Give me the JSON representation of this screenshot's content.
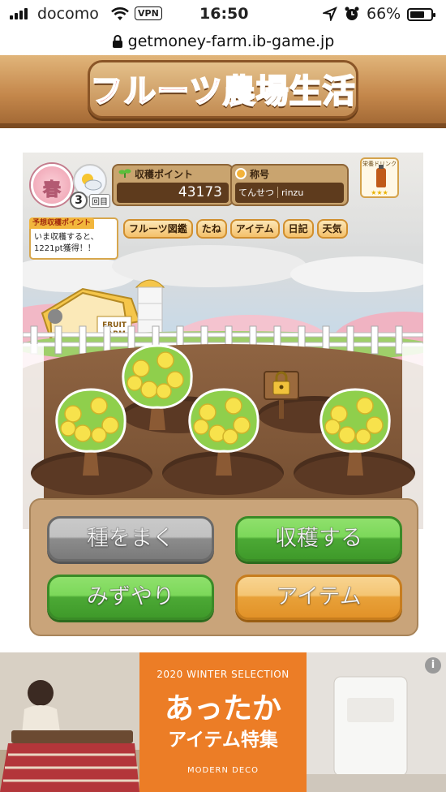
{
  "status_bar": {
    "carrier": "docomo",
    "vpn_label": "VPN",
    "time": "16:50",
    "battery": "66%",
    "battery_level": 0.66
  },
  "browser": {
    "url": "getmoney-farm.ib-game.jp"
  },
  "header": {
    "logo_text": "フルーツ農場生活"
  },
  "hud": {
    "season": "春",
    "round_number": "3",
    "round_unit": "回目",
    "points_label": "収穫ポイント",
    "points_value": "43173",
    "title_label": "称号",
    "title_rank": "てんせつ",
    "username": "rinzu",
    "drink_label": "栄養ドリンク",
    "drink_stars": "★★★",
    "forecast_title": "予想収穫ポイント",
    "forecast_line1": "いま収穫すると、",
    "forecast_line2": "1221pt獲得！！",
    "barn_sign_line1": "FRUIT",
    "barn_sign_line2": "FARM"
  },
  "menu_tabs": [
    {
      "label": "フルーツ図鑑"
    },
    {
      "label": "たね"
    },
    {
      "label": "アイテム"
    },
    {
      "label": "日記"
    },
    {
      "label": "天気"
    }
  ],
  "actions": {
    "sow": "種をまく",
    "harvest": "収穫する",
    "water": "みずやり",
    "item": "アイテム"
  },
  "ad": {
    "season_text": "2020 WINTER SELECTION",
    "headline": "あったか",
    "subline": "アイテム特集",
    "brand": "MODERN DECO",
    "info": "i"
  },
  "colors": {
    "sow_button": "#8c8c8c",
    "harvest_button": "#4ca935",
    "water_button": "#4ca935",
    "item_button": "#e8a139",
    "ad_background": "#ec7d26"
  },
  "icons": [
    "signal-icon",
    "wifi-icon",
    "location-icon",
    "alarm-icon",
    "battery-icon",
    "lock-icon",
    "sun-cloud-icon",
    "sprout-icon",
    "medal-icon",
    "padlock-icon"
  ]
}
